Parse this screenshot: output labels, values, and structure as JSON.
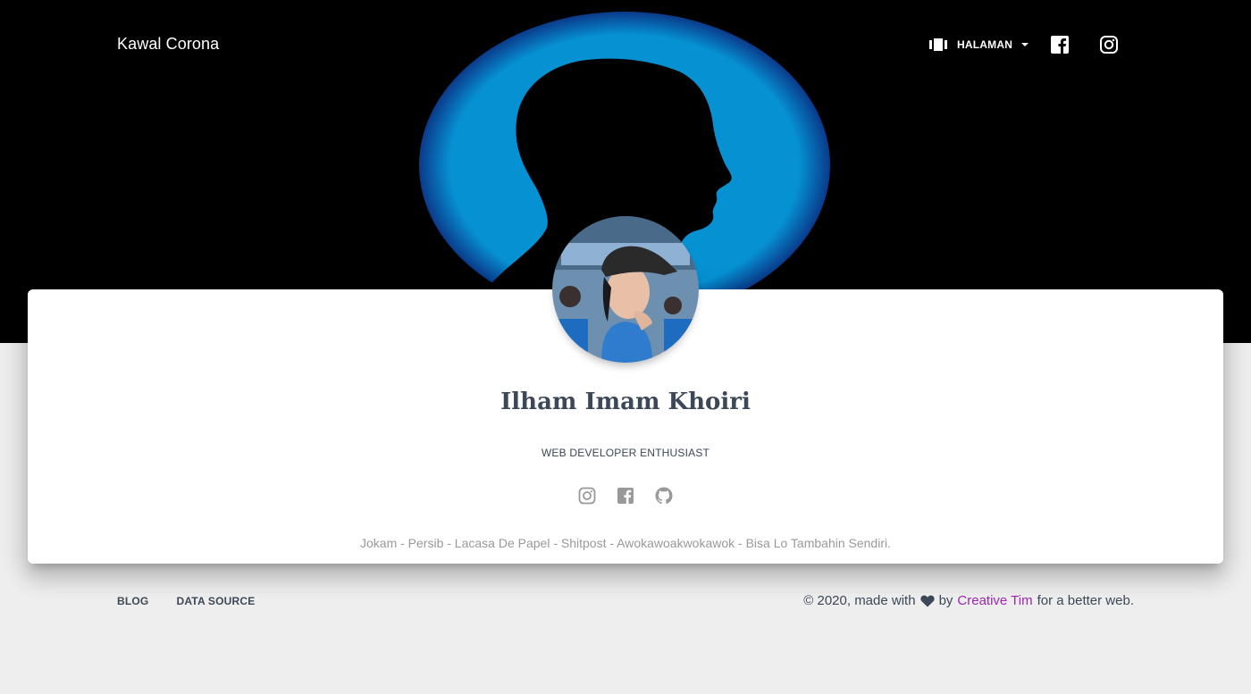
{
  "navbar": {
    "brand": "Kawal Corona",
    "menu_label": "HALAMAN",
    "menu_icon": "view-carousel-icon",
    "social_icons": [
      "facebook-icon",
      "instagram-icon"
    ]
  },
  "profile": {
    "name": "Ilham Imam Khoiri",
    "role": "WEB DEVELOPER ENTHUSIAST",
    "social_icons": [
      "instagram-icon",
      "facebook-icon",
      "github-icon"
    ],
    "description": "Jokam - Persib - Lacasa De Papel - Shitpost - Awokawoakwokawok - Bisa Lo Tambahin Sendiri."
  },
  "footer": {
    "links": [
      "BLOG",
      "DATA SOURCE"
    ],
    "copyright_prefix": "© 2020, made with",
    "copyright_by": "by",
    "copyright_link": "Creative Tim",
    "copyright_suffix": "for a better web."
  },
  "colors": {
    "hero_background": "#000000",
    "hero_circle": "#0691d3",
    "card": "#ffffff",
    "page_background": "#eeeeee",
    "text_dark": "#3c4858",
    "text_muted": "#999999",
    "link_accent": "#9c27b0"
  }
}
